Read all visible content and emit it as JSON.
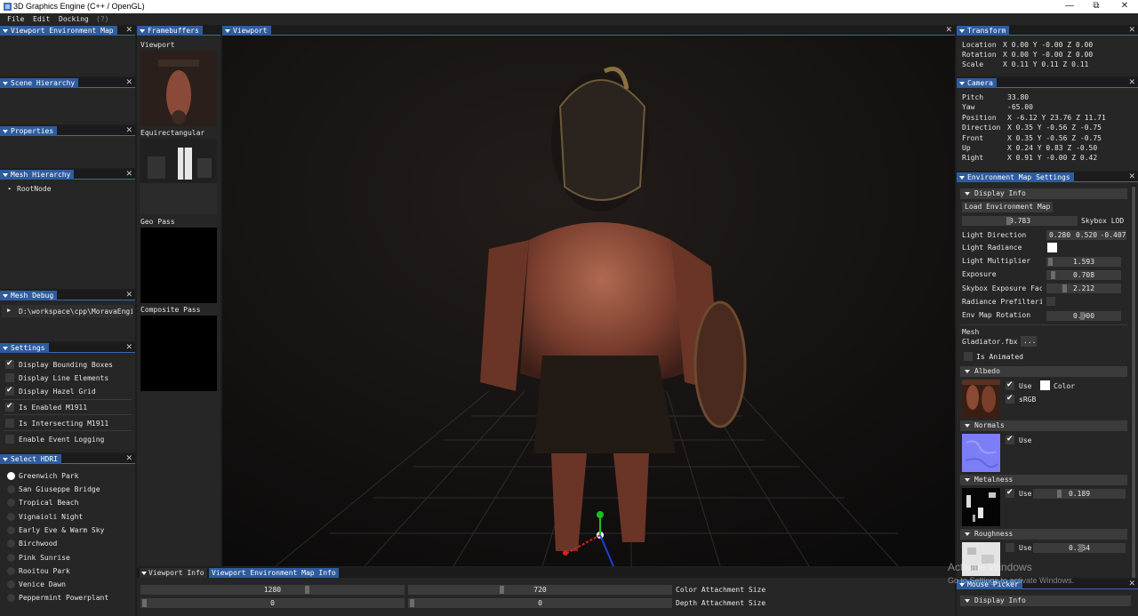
{
  "window": {
    "title": "3D Graphics Engine (C++ / OpenGL)",
    "minimize": "—",
    "restore": "⧉",
    "close": "✕"
  },
  "menu": {
    "file": "File",
    "edit": "Edit",
    "docking": "Docking",
    "help": "(?)"
  },
  "panels": {
    "viewport_env_map": "Viewport Environment Map",
    "scene_hierarchy": "Scene Hierarchy",
    "properties": "Properties",
    "mesh_hierarchy": "Mesh Hierarchy",
    "mesh_debug": "Mesh Debug",
    "settings": "Settings",
    "select_hdri": "Select HDRI",
    "framebuffers": "Framebuffers",
    "viewport": "Viewport",
    "transform": "Transform",
    "camera": "Camera",
    "env_map_settings": "Environment Map Settings",
    "mouse_picker": "Mouse Picker"
  },
  "mesh_hierarchy": {
    "root": "RootNode"
  },
  "mesh_debug": {
    "path": "D:\\workspace\\cpp\\MoravaEngi"
  },
  "settings": [
    {
      "label": "Display Bounding Boxes",
      "checked": true
    },
    {
      "label": "Display Line Elements",
      "checked": false
    },
    {
      "label": "Display Hazel Grid",
      "checked": true
    },
    {
      "label": "Is Enabled M1911",
      "checked": true
    },
    {
      "label": "Is Intersecting M1911",
      "checked": false
    },
    {
      "label": "Enable Event Logging",
      "checked": false
    }
  ],
  "hdri": {
    "selected": "Greenwich Park",
    "items": [
      "Greenwich Park",
      "San Giuseppe Bridge",
      "Tropical Beach",
      "Vignaioli Night",
      "Early Eve & Warm Sky",
      "Birchwood",
      "Pink Sunrise",
      "Rooitou Park",
      "Venice Dawn",
      "Peppermint Powerplant"
    ]
  },
  "framebuffers": {
    "items": [
      "Viewport",
      "Equirectangular",
      "Geo Pass",
      "Composite Pass"
    ]
  },
  "transform": {
    "location": {
      "label": "Location",
      "value": "X 0.00 Y -0.00 Z 0.00"
    },
    "rotation": {
      "label": "Rotation",
      "value": "X 0.00 Y -0.00 Z 0.00"
    },
    "scale": {
      "label": "Scale",
      "value": "X 0.11 Y 0.11 Z 0.11"
    }
  },
  "camera": {
    "rows": [
      {
        "label": "Pitch",
        "value": "33.80"
      },
      {
        "label": "Yaw",
        "value": "-65.00"
      },
      {
        "label": "Position",
        "value": "X -6.12 Y 23.76 Z 11.71"
      },
      {
        "label": "Direction",
        "value": "X 0.35 Y -0.56 Z -0.75"
      },
      {
        "label": "Front",
        "value": "X 0.35 Y -0.56 Z -0.75"
      },
      {
        "label": "Up",
        "value": "X 0.24 Y 0.83 Z -0.50"
      },
      {
        "label": "Right",
        "value": "X 0.91 Y -0.00 Z 0.42"
      }
    ]
  },
  "env": {
    "display_info": "Display Info",
    "load_button": "Load Environment Map",
    "skybox_lod": {
      "value": "0.783",
      "label": "Skybox LOD",
      "fraction": 0.783
    },
    "light_direction": {
      "label": "Light Direction",
      "x": "0.280",
      "y": "0.520",
      "z": "-0.407"
    },
    "light_radiance": {
      "label": "Light Radiance",
      "color": "#ffffff"
    },
    "light_multiplier": {
      "label": "Light Multiplier",
      "value": "1.593"
    },
    "exposure": {
      "label": "Exposure",
      "value": "0.708"
    },
    "skybox_exposure": {
      "label": "Skybox Exposure Fac",
      "value": "2.212"
    },
    "radiance_prefilter": {
      "label": "Radiance Prefilteri"
    },
    "env_map_rotation": {
      "label": "Env Map Rotation",
      "value": "0.000"
    },
    "mesh_label": "Mesh",
    "mesh_file": "Gladiator.fbx",
    "browse": "...",
    "is_animated": "Is Animated",
    "albedo": {
      "title": "Albedo",
      "use": "Use",
      "color": "Color",
      "srgb": "sRGB",
      "swatch": "#ffffff"
    },
    "normals": {
      "title": "Normals",
      "use": "Use"
    },
    "metalness": {
      "title": "Metalness",
      "use": "Use",
      "value": "0.189"
    },
    "roughness": {
      "title": "Roughness",
      "use": "Use",
      "value": "0.364"
    }
  },
  "mouse_picker": {
    "display_info": "Display Info"
  },
  "bottom": {
    "tab_info": "Viewport Info",
    "tab_env": "Viewport Environment Map Info",
    "color_w": "1280",
    "color_h": "720",
    "color_label": "Color Attachment Size",
    "depth_w": "0",
    "depth_h": "0",
    "depth_label": "Depth Attachment Size"
  },
  "watermark": {
    "line1": "Activate Windows",
    "line2": "Go to Settings to activate Windows."
  },
  "colors": {
    "accent": "#2e5c9e",
    "panel": "#262626",
    "widget": "#3b3b3b"
  }
}
